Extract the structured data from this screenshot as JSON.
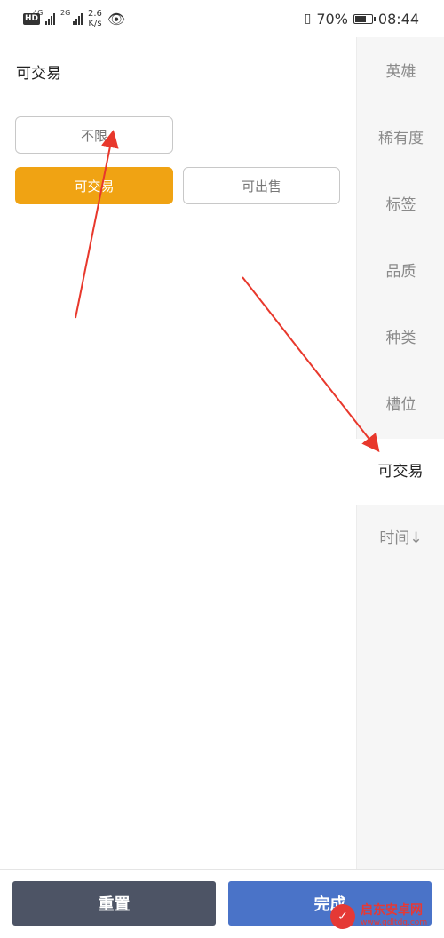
{
  "status_bar": {
    "net1": "4G",
    "net2": "2G",
    "speed_value": "2.6",
    "speed_unit": "K/s",
    "battery_percent_text": "70%",
    "battery_level": 0.7,
    "time": "08:44",
    "hd_label": "HD"
  },
  "filter": {
    "section_title": "可交易",
    "options": [
      {
        "label": "不限",
        "selected": false
      },
      {
        "label": "可交易",
        "selected": true
      },
      {
        "label": "可出售",
        "selected": false
      }
    ]
  },
  "sidebar": {
    "items": [
      {
        "label": "英雄",
        "active": false
      },
      {
        "label": "稀有度",
        "active": false
      },
      {
        "label": "标签",
        "active": false
      },
      {
        "label": "品质",
        "active": false
      },
      {
        "label": "种类",
        "active": false
      },
      {
        "label": "槽位",
        "active": false
      },
      {
        "label": "可交易",
        "active": true
      },
      {
        "label": "时间↓",
        "active": false
      }
    ]
  },
  "footer": {
    "reset_label": "重置",
    "done_label": "完成"
  },
  "watermark": {
    "name": "启东安卓网",
    "url": "www.qdltdq.com"
  },
  "colors": {
    "accent": "#f0a313",
    "reset_button": "#4d5465",
    "done_button": "#4a73c8",
    "annotation": "#e8382c"
  }
}
